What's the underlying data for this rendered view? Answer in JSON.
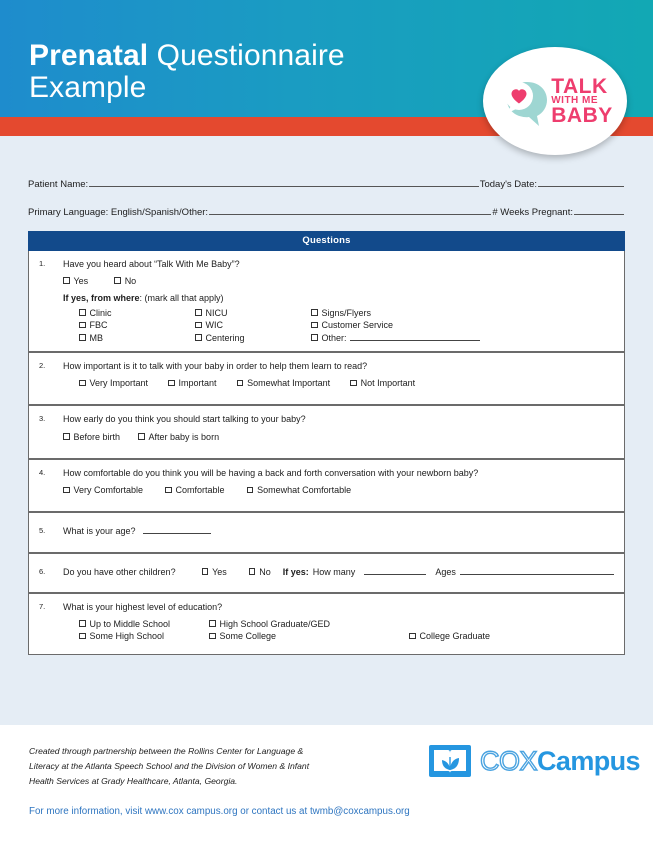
{
  "header": {
    "title_strong": "Prenatal",
    "title_light": " Questionnaire",
    "title_line2": "Example",
    "logo": {
      "line1": "TALK",
      "line2": "WITH ME",
      "line3": "BABY",
      "bubble_color": "#9ed6d2",
      "heart_color": "#ee3d6e"
    },
    "gradient_from": "#1e8ccd",
    "gradient_to": "#12a8b4",
    "stripe_color": "#e4492f"
  },
  "patient_info": {
    "name_label": "Patient Name:",
    "date_label": "Today's Date:",
    "language_label": "Primary Language: English/Spanish/Other:",
    "weeks_label": "# Weeks Pregnant:"
  },
  "questions_header": "Questions",
  "questions": [
    {
      "num": "1.",
      "text": "Have you heard about “Talk With Me Baby”?",
      "yes": "Yes",
      "no": "No",
      "subhead_bold": "If yes, from where",
      "subhead_rest": ": (mark all that apply)",
      "options": [
        "Clinic",
        "NICU",
        "Signs/Flyers",
        "FBC",
        "WIC",
        "Customer Service",
        "MB",
        "Centering",
        "Other:"
      ]
    },
    {
      "num": "2.",
      "text": "How important is it to talk with your baby in order to help them learn to read?",
      "options": [
        "Very Important",
        "Important",
        "Somewhat Important",
        "Not Important"
      ]
    },
    {
      "num": "3.",
      "text": "How early do you think you should start talking to your baby?",
      "options": [
        "Before birth",
        "After baby is born"
      ]
    },
    {
      "num": "4.",
      "text": "How comfortable do you think you will be having a back and forth conversation with your newborn baby?",
      "options": [
        "Very Comfortable",
        "Comfortable",
        "Somewhat Comfortable"
      ]
    },
    {
      "num": "5.",
      "text": "What is your age?"
    },
    {
      "num": "6.",
      "text": "Do you have other children?",
      "yes": "Yes",
      "no": "No",
      "ifyes_bold": "If yes:",
      "howmany": "How many",
      "ages": "Ages"
    },
    {
      "num": "7.",
      "text": "What is your highest level of education?",
      "options": [
        "Up to Middle School",
        "High School Graduate/GED",
        "Some High School",
        "Some College",
        "College Graduate"
      ]
    }
  ],
  "footer": {
    "credit_line1": "Created through partnership between the Rollins Center for Language &",
    "credit_line2": "Literacy at the Atlanta Speech School and the Division of Women & Infant",
    "credit_line3": "Health Services at Grady Healthcare, Atlanta, Georgia.",
    "link_text": "For more information, visit www.cox campus.org or contact us at twmb@coxcampus.org",
    "link_color": "#2e75c0",
    "cox_logo": {
      "cox": "COX",
      "campus": "Campus",
      "color": "#2596e0"
    }
  }
}
